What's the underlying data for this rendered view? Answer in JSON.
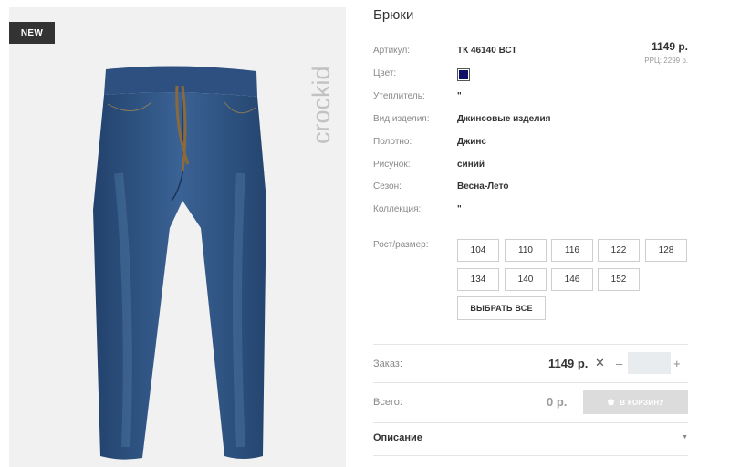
{
  "image": {
    "badge": "NEW",
    "brand": "crockid"
  },
  "product": {
    "title": "Брюки",
    "price": "1149 р.",
    "rrp": "РРЦ: 2299 р.",
    "swatch_color": "#0d1065",
    "attributes": [
      {
        "label": "Артикул:",
        "value": "ТК 46140 ВСТ"
      },
      {
        "label": "Цвет:",
        "value": ""
      },
      {
        "label": "Утеплитель:",
        "value": "\""
      },
      {
        "label": "Вид изделия:",
        "value": "Джинсовые изделия"
      },
      {
        "label": "Полотно:",
        "value": "Джинс"
      },
      {
        "label": "Рисунок:",
        "value": "синий"
      },
      {
        "label": "Сезон:",
        "value": "Весна-Лето"
      },
      {
        "label": "Коллекция:",
        "value": "\""
      }
    ],
    "sizes_label": "Рост/размер:",
    "sizes": [
      "104",
      "110",
      "116",
      "122",
      "128",
      "134",
      "140",
      "146",
      "152"
    ],
    "select_all": "ВЫБРАТЬ ВСЕ"
  },
  "order": {
    "label": "Заказ:",
    "price": "1149 р.",
    "times": "✕",
    "minus": "–",
    "plus": "+",
    "qty": ""
  },
  "total": {
    "label": "Всего:",
    "value": "0 р.",
    "cart_button": "В КОРЗИНУ"
  },
  "description": {
    "label": "Описание",
    "chevron": "▼"
  }
}
